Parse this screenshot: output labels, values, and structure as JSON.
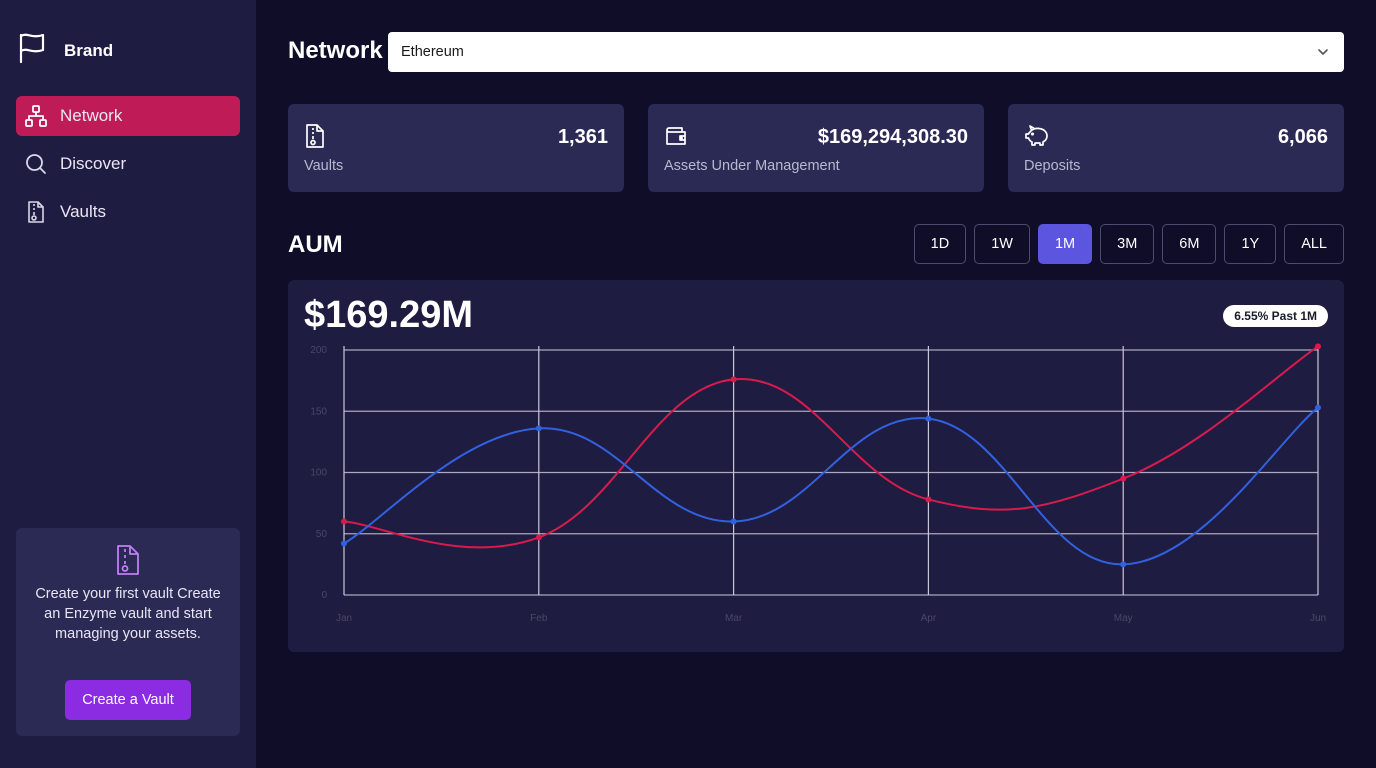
{
  "brand": {
    "label": "Brand",
    "icon": "flag-icon"
  },
  "sidebar": {
    "items": [
      {
        "label": "Network",
        "icon": "network-icon",
        "active": true
      },
      {
        "label": "Discover",
        "icon": "search-icon",
        "active": false
      },
      {
        "label": "Vaults",
        "icon": "vault-file-icon",
        "active": false
      }
    ],
    "promo": {
      "text": "Create your first vault Create an Enzyme vault and start managing your assets.",
      "button_label": "Create a Vault"
    }
  },
  "header": {
    "title": "Network",
    "network_select": {
      "value": "Ethereum"
    }
  },
  "stats": [
    {
      "value": "1,361",
      "label": "Vaults",
      "icon": "vault-file-icon"
    },
    {
      "value": "$169,294,308.30",
      "label": "Assets Under Management",
      "icon": "wallet-icon"
    },
    {
      "value": "6,066",
      "label": "Deposits",
      "icon": "piggy-bank-icon"
    }
  ],
  "aum": {
    "title": "AUM",
    "ranges": [
      "1D",
      "1W",
      "1M",
      "3M",
      "6M",
      "1Y",
      "ALL"
    ],
    "active_range": "1M",
    "headline": "$169.29M",
    "change_badge": "6.55% Past 1M"
  },
  "colors": {
    "red_series": "#d81b4d",
    "blue_series": "#3261e0",
    "accent": "#5b55e0",
    "nav_active": "#bf1c57",
    "promo_button": "#8b2be2"
  },
  "chart_data": {
    "type": "line",
    "categories": [
      "Jan",
      "Feb",
      "Mar",
      "Apr",
      "May",
      "Jun"
    ],
    "y_ticks": [
      "0",
      "50",
      "100",
      "150",
      "200"
    ],
    "ylim": [
      0,
      200
    ],
    "grid": true,
    "series": [
      {
        "values": [
          60,
          47,
          176,
          78,
          95,
          203
        ],
        "color": "#d81b4d"
      },
      {
        "values": [
          42,
          136,
          60,
          144,
          25,
          153
        ],
        "color": "#3261e0"
      }
    ]
  }
}
